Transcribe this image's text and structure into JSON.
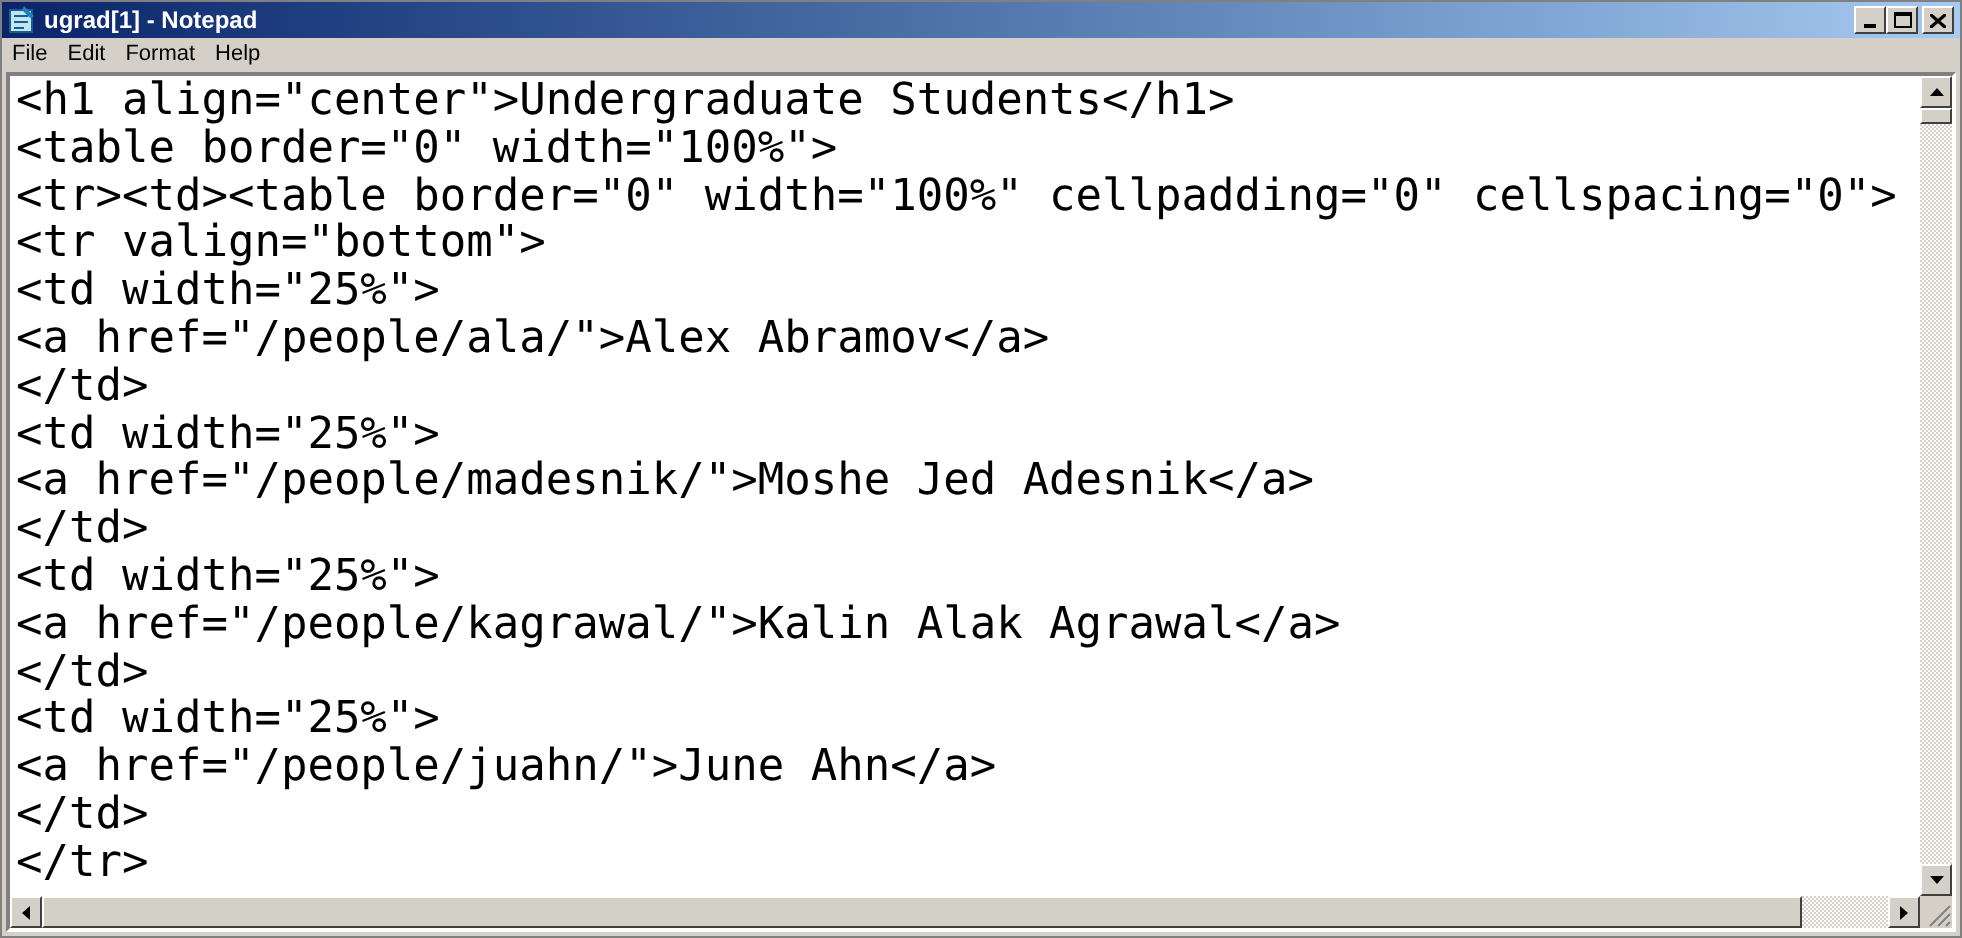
{
  "window": {
    "title": "ugrad[1] - Notepad"
  },
  "menu": [
    {
      "label": "File"
    },
    {
      "label": "Edit"
    },
    {
      "label": "Format"
    },
    {
      "label": "Help"
    }
  ],
  "editor": {
    "lines": [
      "<h1 align=\"center\">Undergraduate Students</h1>",
      "<table border=\"0\" width=\"100%\">",
      "<tr><td><table border=\"0\" width=\"100%\" cellpadding=\"0\" cellspacing=\"0\">",
      "<tr valign=\"bottom\">",
      "<td width=\"25%\">",
      "<a href=\"/people/ala/\">Alex Abramov</a>",
      "</td>",
      "<td width=\"25%\">",
      "<a href=\"/people/madesnik/\">Moshe Jed Adesnik</a>",
      "</td>",
      "<td width=\"25%\">",
      "<a href=\"/people/kagrawal/\">Kalin Alak Agrawal</a>",
      "</td>",
      "<td width=\"25%\">",
      "<a href=\"/people/juahn/\">June Ahn</a>",
      "</td>",
      "</tr>"
    ]
  }
}
